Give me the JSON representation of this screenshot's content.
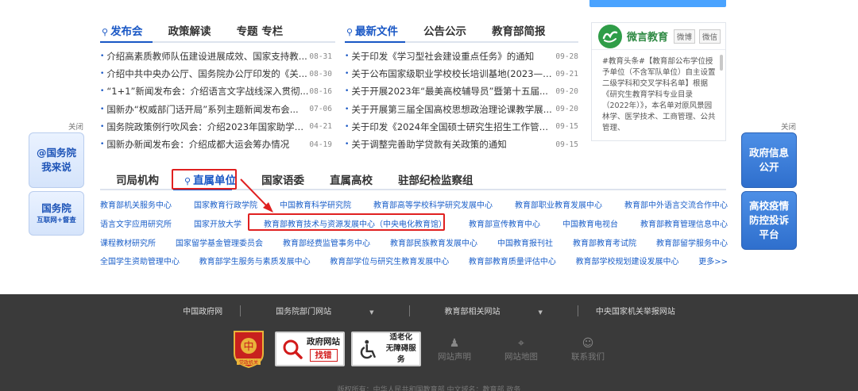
{
  "tabs_left": [
    {
      "label": "发布会",
      "active": true
    },
    {
      "label": "政策解读",
      "active": false
    },
    {
      "label": "专题 专栏",
      "active": false
    }
  ],
  "tabs_right": [
    {
      "label": "最新文件",
      "active": true
    },
    {
      "label": "公告公示",
      "active": false
    },
    {
      "label": "教育部简报",
      "active": false
    }
  ],
  "news_left": [
    {
      "title": "介绍高素质教师队伍建设进展成效、国家支持教...",
      "date": "08-31"
    },
    {
      "title": "介绍中共中央办公厅、国务院办公厅印发的《关...",
      "date": "08-30"
    },
    {
      "title": "“1+1”新闻发布会：介绍语言文字战线深入贯彻...",
      "date": "08-16"
    },
    {
      "title": "国新办“权威部门话开局”系列主题新闻发布会...",
      "date": "07-06"
    },
    {
      "title": "国务院政策例行吹风会：介绍2023年国家助学贷...",
      "date": "04-21"
    },
    {
      "title": "国新办新闻发布会：介绍成都大运会筹办情况",
      "date": "04-19"
    }
  ],
  "news_right": [
    {
      "title": "关于印发《学习型社会建设重点任务》的通知",
      "date": "09-28"
    },
    {
      "title": "关于公布国家级职业学校校长培训基地(2023—2...",
      "date": "09-21"
    },
    {
      "title": "关于开展2023年“最美高校辅导员”暨第十五届...",
      "date": "09-20"
    },
    {
      "title": "关于开展第三届全国高校思想政治理论课教学展...",
      "date": "09-20"
    },
    {
      "title": "关于印发《2024年全国硕士研究生招生工作管理...",
      "date": "09-15"
    },
    {
      "title": "关于调整完善助学贷款有关政策的通知",
      "date": "09-15"
    }
  ],
  "weibo": {
    "title": "微言教育",
    "tag1": "微博",
    "tag2": "微信",
    "body": "#教育头条#【教育部公布学位授予单位（不含军队单位）自主设置二级学科和交叉学科名单】根据《研究生教育学科专业目录（2022年）》，本名单对原风景园林学、医学技术、工商管理、公共管理、"
  },
  "close_label": "关闭",
  "left_buttons": [
    {
      "line1": "@国务院",
      "line2": "我来说"
    },
    {
      "line1": "国务院",
      "line2": "互联网+督查"
    }
  ],
  "right_buttons": [
    {
      "line1": "政府信息",
      "line2": "公开"
    },
    {
      "line1": "高校疫情",
      "line2": "防控投诉",
      "line3": "平台"
    }
  ],
  "unit_tabs": [
    {
      "label": "司局机构",
      "active": false
    },
    {
      "label": "直属单位",
      "active": true
    },
    {
      "label": "国家语委",
      "active": false
    },
    {
      "label": "直属高校",
      "active": false
    },
    {
      "label": "驻部纪检监察组",
      "active": false
    }
  ],
  "unit_links": [
    [
      "教育部机关服务中心",
      "国家教育行政学院",
      "中国教育科学研究院",
      "教育部高等学校科学研究发展中心",
      "教育部职业教育发展中心",
      "教育部中外语言交流合作中心"
    ],
    [
      "语言文字应用研究所",
      "国家开放大学",
      "教育部教育技术与资源发展中心（中央电化教育馆）",
      "教育部宣传教育中心",
      "中国教育电视台",
      "教育部教育管理信息中心"
    ],
    [
      "课程教材研究所",
      "国家留学基金管理委员会",
      "教育部经费监管事务中心",
      "教育部民族教育发展中心",
      "中国教育报刊社",
      "教育部教育考试院",
      "教育部留学服务中心"
    ],
    [
      "全国学生资助管理中心",
      "教育部学生服务与素质发展中心",
      "教育部学位与研究生教育发展中心",
      "教育部教育质量评估中心",
      "教育部学校规划建设发展中心",
      "更多>>"
    ]
  ],
  "footer_nav": [
    {
      "label": "中国政府网",
      "caret": false
    },
    {
      "label": "国务院部门网站",
      "caret": true
    },
    {
      "label": "教育部相关网站",
      "caret": true
    },
    {
      "label": "中央国家机关举报网站",
      "caret": false
    }
  ],
  "footer_badges": {
    "gov_site": {
      "line1": "政府网站",
      "line2": "找错"
    },
    "elderly": {
      "line1": "适老化",
      "line2": "无障碍服务"
    },
    "party": "党政机关"
  },
  "footer_icons": [
    {
      "label": "网站声明",
      "icon": "person-icon"
    },
    {
      "label": "网站地图",
      "icon": "map-pin-icon"
    },
    {
      "label": "联系我们",
      "icon": "contacts-icon"
    }
  ],
  "copyright": "版权所有：中华人民共和国教育部  中文域名：教育部.政务"
}
